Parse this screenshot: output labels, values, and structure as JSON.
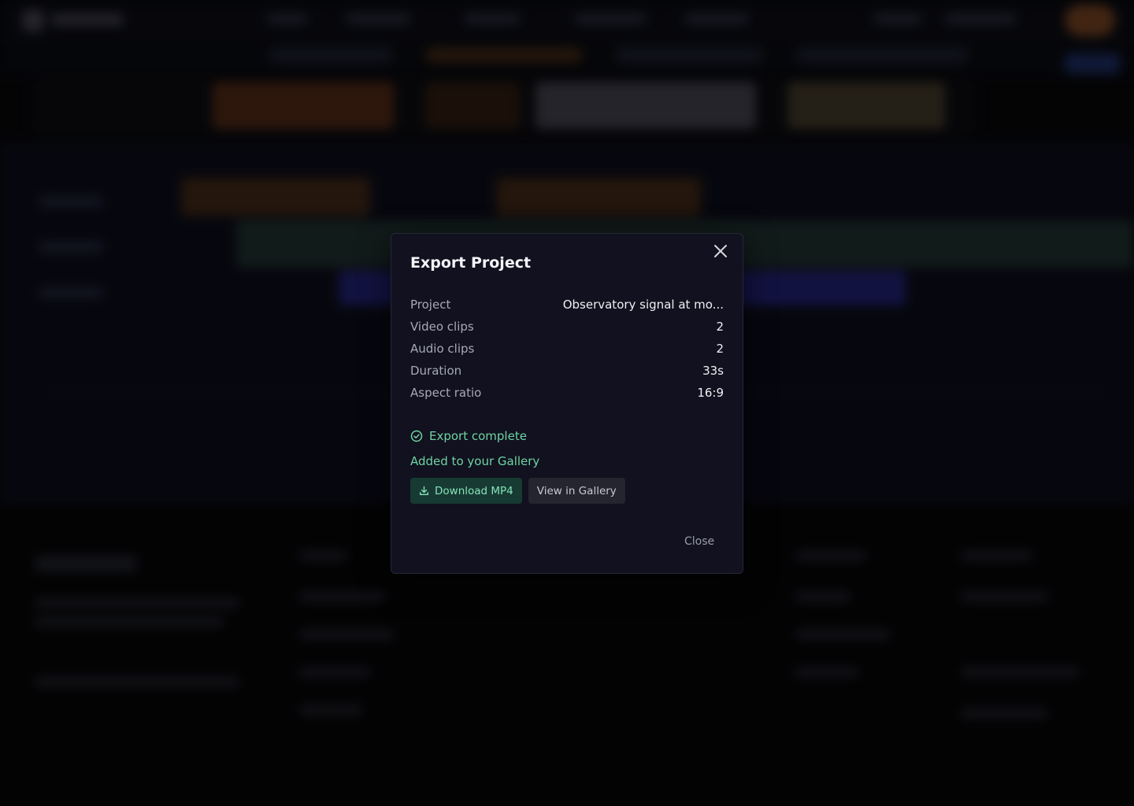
{
  "modal": {
    "title": "Export Project",
    "close_icon": "close-icon",
    "rows": [
      {
        "label": "Project",
        "value": "Observatory signal at mo..."
      },
      {
        "label": "Video clips",
        "value": "2"
      },
      {
        "label": "Audio clips",
        "value": "2"
      },
      {
        "label": "Duration",
        "value": "33s"
      },
      {
        "label": "Aspect ratio",
        "value": "16:9"
      }
    ],
    "status": {
      "icon": "check-circle-icon",
      "text": "Export complete",
      "color": "#6ed4a2"
    },
    "gallery_note": "Added to your Gallery",
    "download_button": {
      "icon": "download-icon",
      "label": "Download MP4"
    },
    "view_gallery_button": {
      "label": "View in Gallery"
    },
    "close_button": {
      "label": "Close"
    }
  },
  "colors": {
    "accent_green": "#6ed4a2",
    "modal_background": "#11111f",
    "page_background": "#070709"
  }
}
